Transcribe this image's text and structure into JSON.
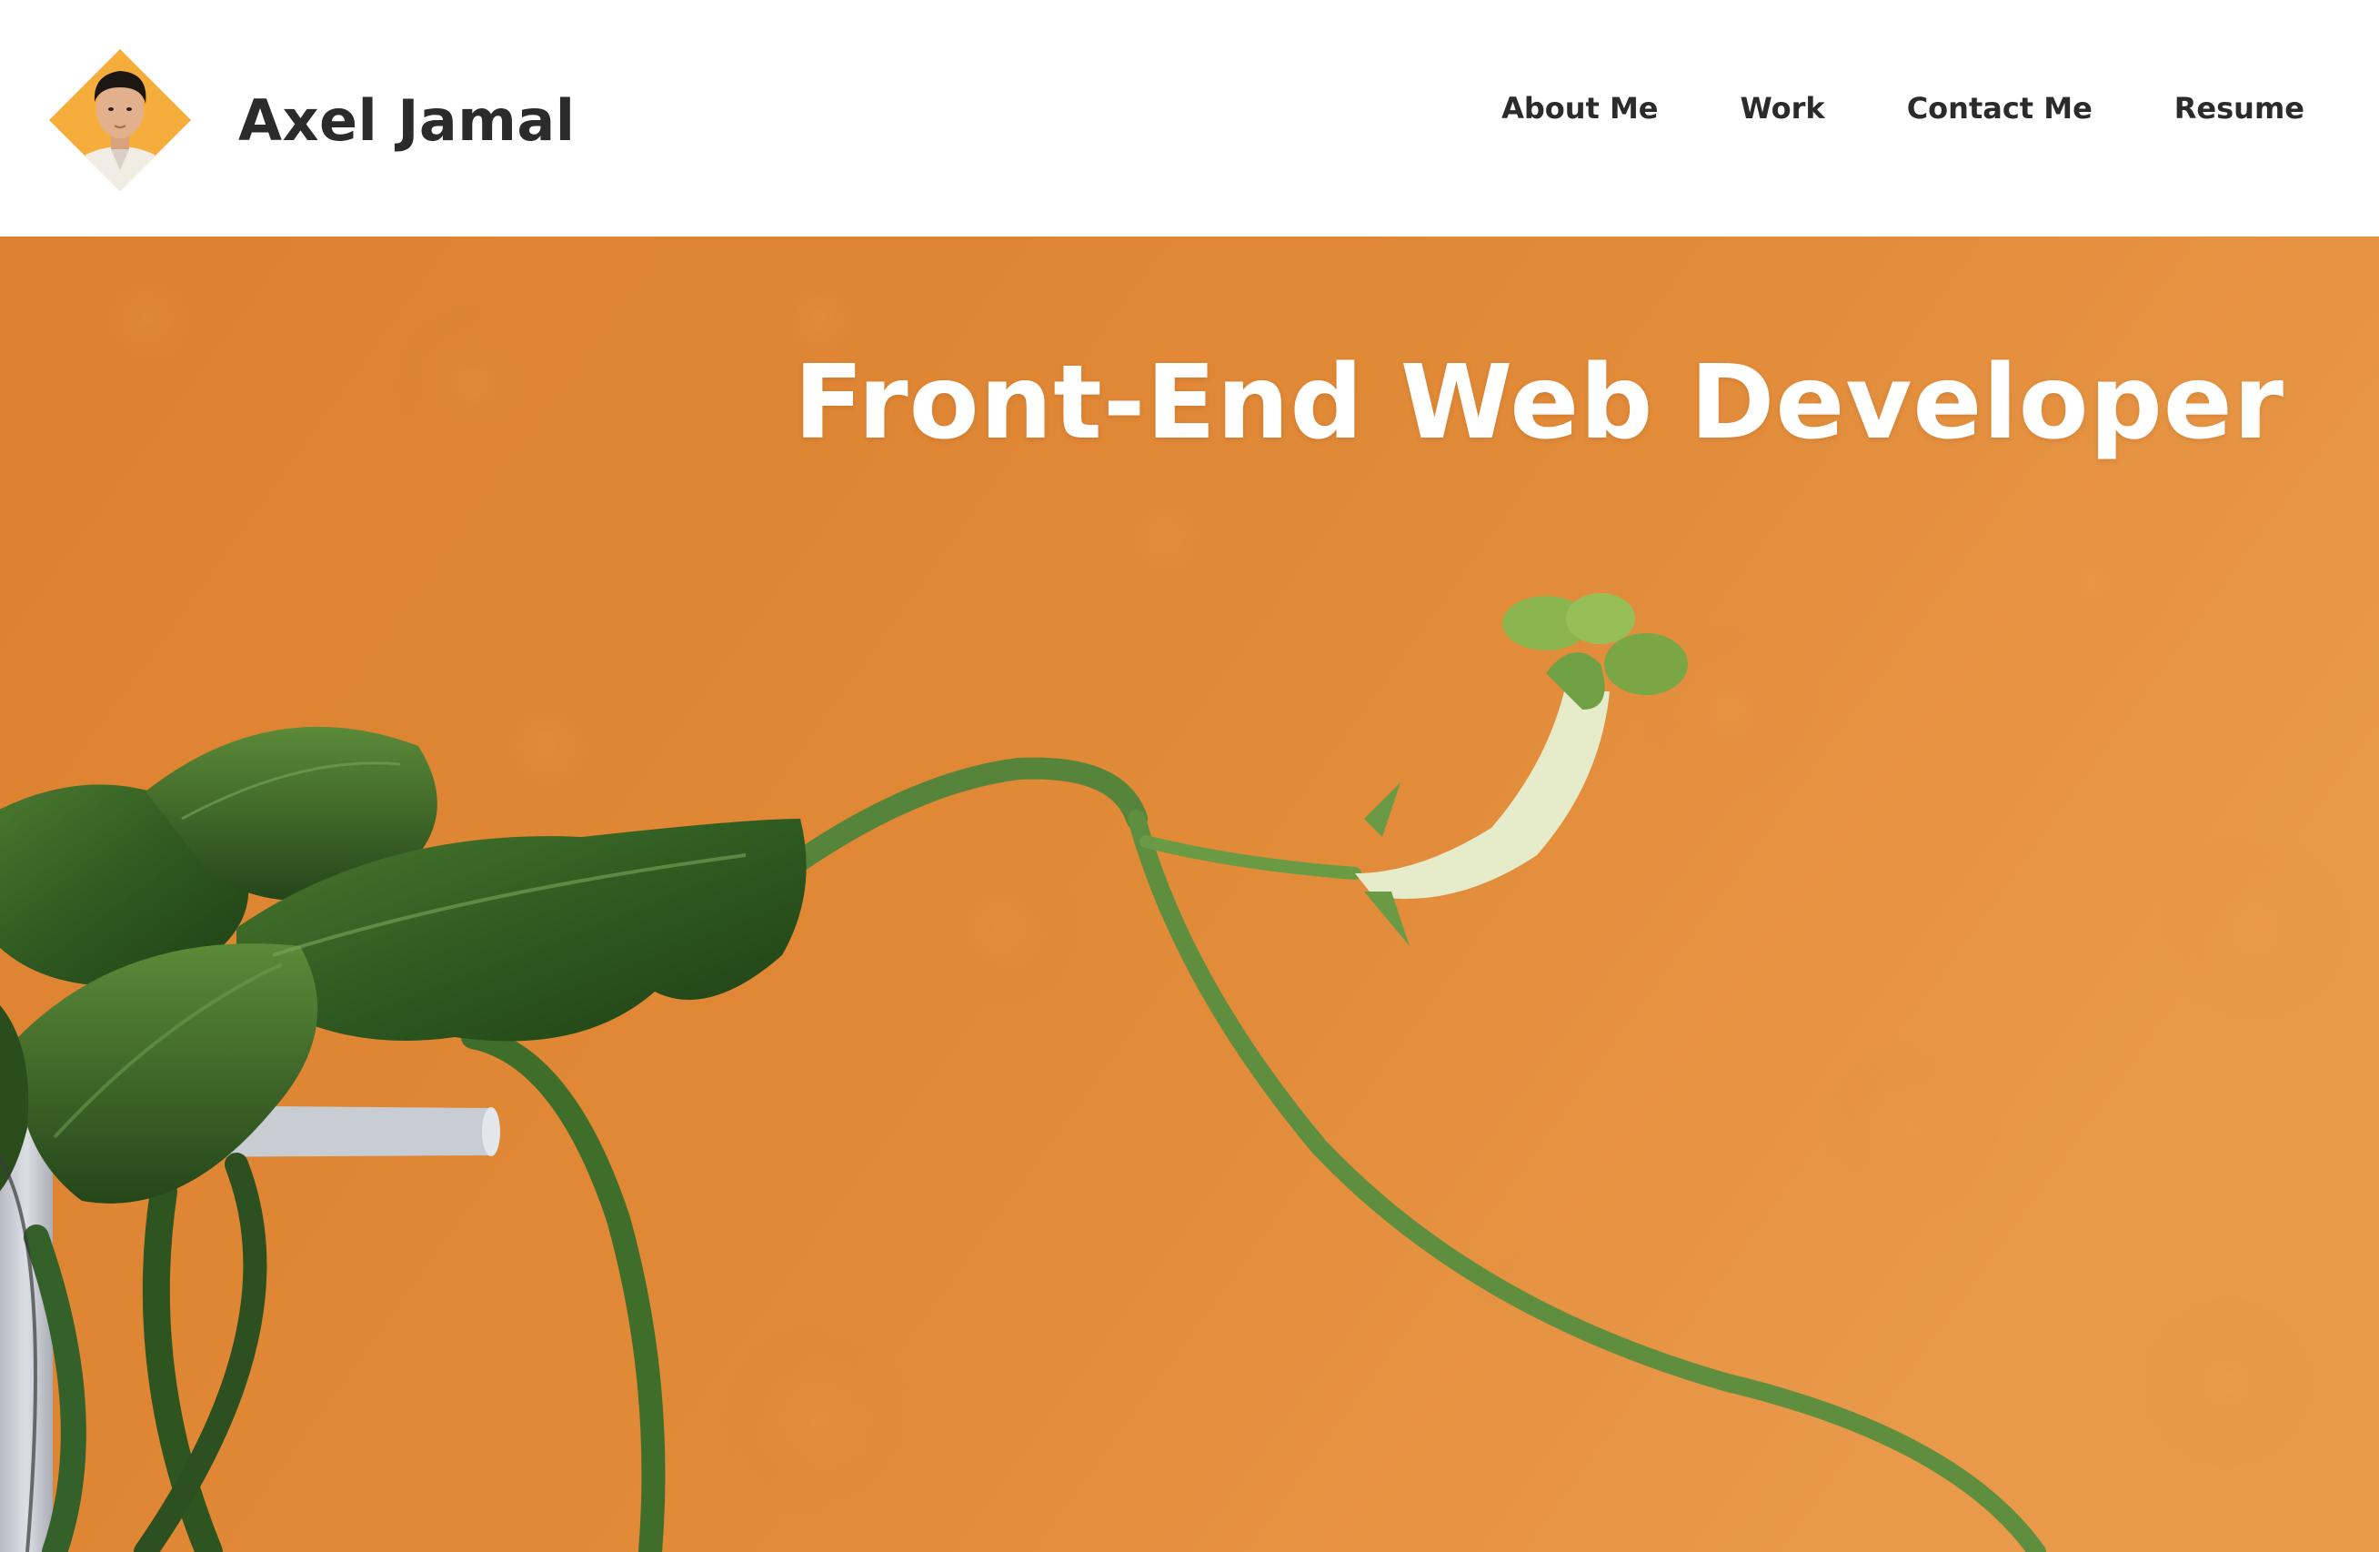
{
  "site": {
    "name": "Axel Jamal"
  },
  "nav": {
    "items": [
      {
        "label": "About Me"
      },
      {
        "label": "Work"
      },
      {
        "label": "Contact Me"
      },
      {
        "label": "Resume"
      }
    ]
  },
  "hero": {
    "title": "Front-End Web Developer"
  },
  "colors": {
    "logo_diamond": "#f5ae3c",
    "hero_background": "#e08a36",
    "text_dark": "#2b2b2b",
    "hero_text": "#ffffff"
  }
}
